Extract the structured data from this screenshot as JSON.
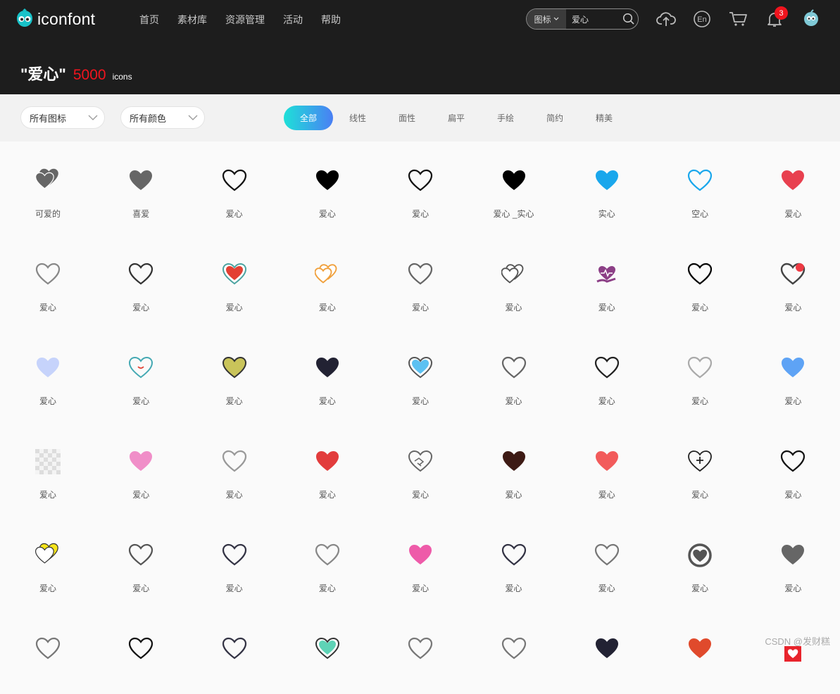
{
  "header": {
    "logo_text": "iconfont",
    "nav": [
      "首页",
      "素材库",
      "资源管理",
      "活动",
      "帮助"
    ],
    "search": {
      "type": "图标",
      "value": "爱心"
    },
    "notification_count": "3",
    "upload_icon": "upload-cloud-icon",
    "language_icon": "language-en-icon",
    "cart_icon": "cart-icon",
    "bell_icon": "bell-icon",
    "avatar_icon": "avatar"
  },
  "title": {
    "query": "\"爱心\"",
    "count": "5000",
    "unit": "icons"
  },
  "filters": {
    "type_select": "所有图标",
    "color_select": "所有颜色",
    "tabs": [
      "全部",
      "线性",
      "面性",
      "扁平",
      "手绘",
      "简约",
      "精美"
    ],
    "active_tab": "全部"
  },
  "icons": [
    {
      "label": "可爱的",
      "style": "double",
      "color": "#666666"
    },
    {
      "label": "喜爱",
      "style": "filled",
      "color": "#666666"
    },
    {
      "label": "爱心",
      "style": "outline",
      "color": "#111111"
    },
    {
      "label": "爱心",
      "style": "filled",
      "color": "#000000"
    },
    {
      "label": "爱心",
      "style": "outline",
      "color": "#111111"
    },
    {
      "label": "爱心 _实心",
      "style": "filled",
      "color": "#000000"
    },
    {
      "label": "实心",
      "style": "filled",
      "color": "#1aa7ec"
    },
    {
      "label": "空心",
      "style": "outline",
      "color": "#1aa7ec"
    },
    {
      "label": "爱心",
      "style": "filled",
      "color": "#e8404f"
    },
    {
      "label": "爱心",
      "style": "outline",
      "color": "#888888"
    },
    {
      "label": "爱心",
      "style": "outline",
      "color": "#333333"
    },
    {
      "label": "爱心",
      "style": "inner",
      "color": "#e34033",
      "accent": "#4aa3a0"
    },
    {
      "label": "爱心",
      "style": "double-outline",
      "color": "#f0a03c"
    },
    {
      "label": "爱心",
      "style": "outline",
      "color": "#666666"
    },
    {
      "label": "爱心",
      "style": "double-outline",
      "color": "#555555"
    },
    {
      "label": "爱心",
      "style": "hand",
      "color": "#8c3f86"
    },
    {
      "label": "爱心",
      "style": "outline",
      "color": "#000000"
    },
    {
      "label": "爱心",
      "style": "dot",
      "color": "#444444",
      "accent": "#ee3a43"
    },
    {
      "label": "爱心",
      "style": "filled",
      "color": "#c6d3fb"
    },
    {
      "label": "爱心",
      "style": "smile",
      "color": "#45a9b3",
      "accent": "#e34033"
    },
    {
      "label": "爱心",
      "style": "filled-stroke",
      "color": "#c9c45a",
      "accent": "#333333"
    },
    {
      "label": "爱心",
      "style": "filled",
      "color": "#222233"
    },
    {
      "label": "爱心",
      "style": "inner",
      "color": "#5cc1f2",
      "accent": "#555555"
    },
    {
      "label": "爱心",
      "style": "outline",
      "color": "#666666"
    },
    {
      "label": "爱心",
      "style": "outline",
      "color": "#222222"
    },
    {
      "label": "爱心",
      "style": "outline",
      "color": "#aaaaaa"
    },
    {
      "label": "爱心",
      "style": "filled",
      "color": "#5ea3f5"
    },
    {
      "label": "爱心",
      "style": "blank",
      "color": "#dddddd"
    },
    {
      "label": "爱心",
      "style": "filled",
      "color": "#f08ec8"
    },
    {
      "label": "爱心",
      "style": "outline",
      "color": "#999999"
    },
    {
      "label": "爱心",
      "style": "filled",
      "color": "#e23c3c"
    },
    {
      "label": "爱心",
      "style": "handshake",
      "color": "#666666"
    },
    {
      "label": "爱心",
      "style": "filled",
      "color": "#3d1a14"
    },
    {
      "label": "爱心",
      "style": "filled",
      "color": "#f25b5b"
    },
    {
      "label": "爱心",
      "style": "plus",
      "color": "#222222"
    },
    {
      "label": "爱心",
      "style": "outline",
      "color": "#111111"
    },
    {
      "label": "爱心",
      "style": "double",
      "color": "#f5e41a",
      "accent": "#333333"
    },
    {
      "label": "爱心",
      "style": "outline",
      "color": "#555555"
    },
    {
      "label": "爱心",
      "style": "outline",
      "color": "#333344"
    },
    {
      "label": "爱心",
      "style": "outline",
      "color": "#888888"
    },
    {
      "label": "爱心",
      "style": "filled",
      "color": "#ee5ba9"
    },
    {
      "label": "爱心",
      "style": "outline",
      "color": "#333344"
    },
    {
      "label": "爱心",
      "style": "outline",
      "color": "#777777"
    },
    {
      "label": "爱心",
      "style": "ring",
      "color": "#555555"
    },
    {
      "label": "爱心",
      "style": "filled",
      "color": "#666666"
    },
    {
      "label": "",
      "style": "outline",
      "color": "#777777"
    },
    {
      "label": "",
      "style": "outline",
      "color": "#111111"
    },
    {
      "label": "",
      "style": "outline",
      "color": "#333344"
    },
    {
      "label": "",
      "style": "inner",
      "color": "#5ed3b6",
      "accent": "#333333"
    },
    {
      "label": "",
      "style": "outline",
      "color": "#777777"
    },
    {
      "label": "",
      "style": "outline",
      "color": "#777777"
    },
    {
      "label": "",
      "style": "filled",
      "color": "#222233"
    },
    {
      "label": "",
      "style": "filled",
      "color": "#e04a2c"
    },
    {
      "label": "",
      "style": "box",
      "color": "#e8242c"
    }
  ],
  "watermark": "CSDN @发财糕"
}
